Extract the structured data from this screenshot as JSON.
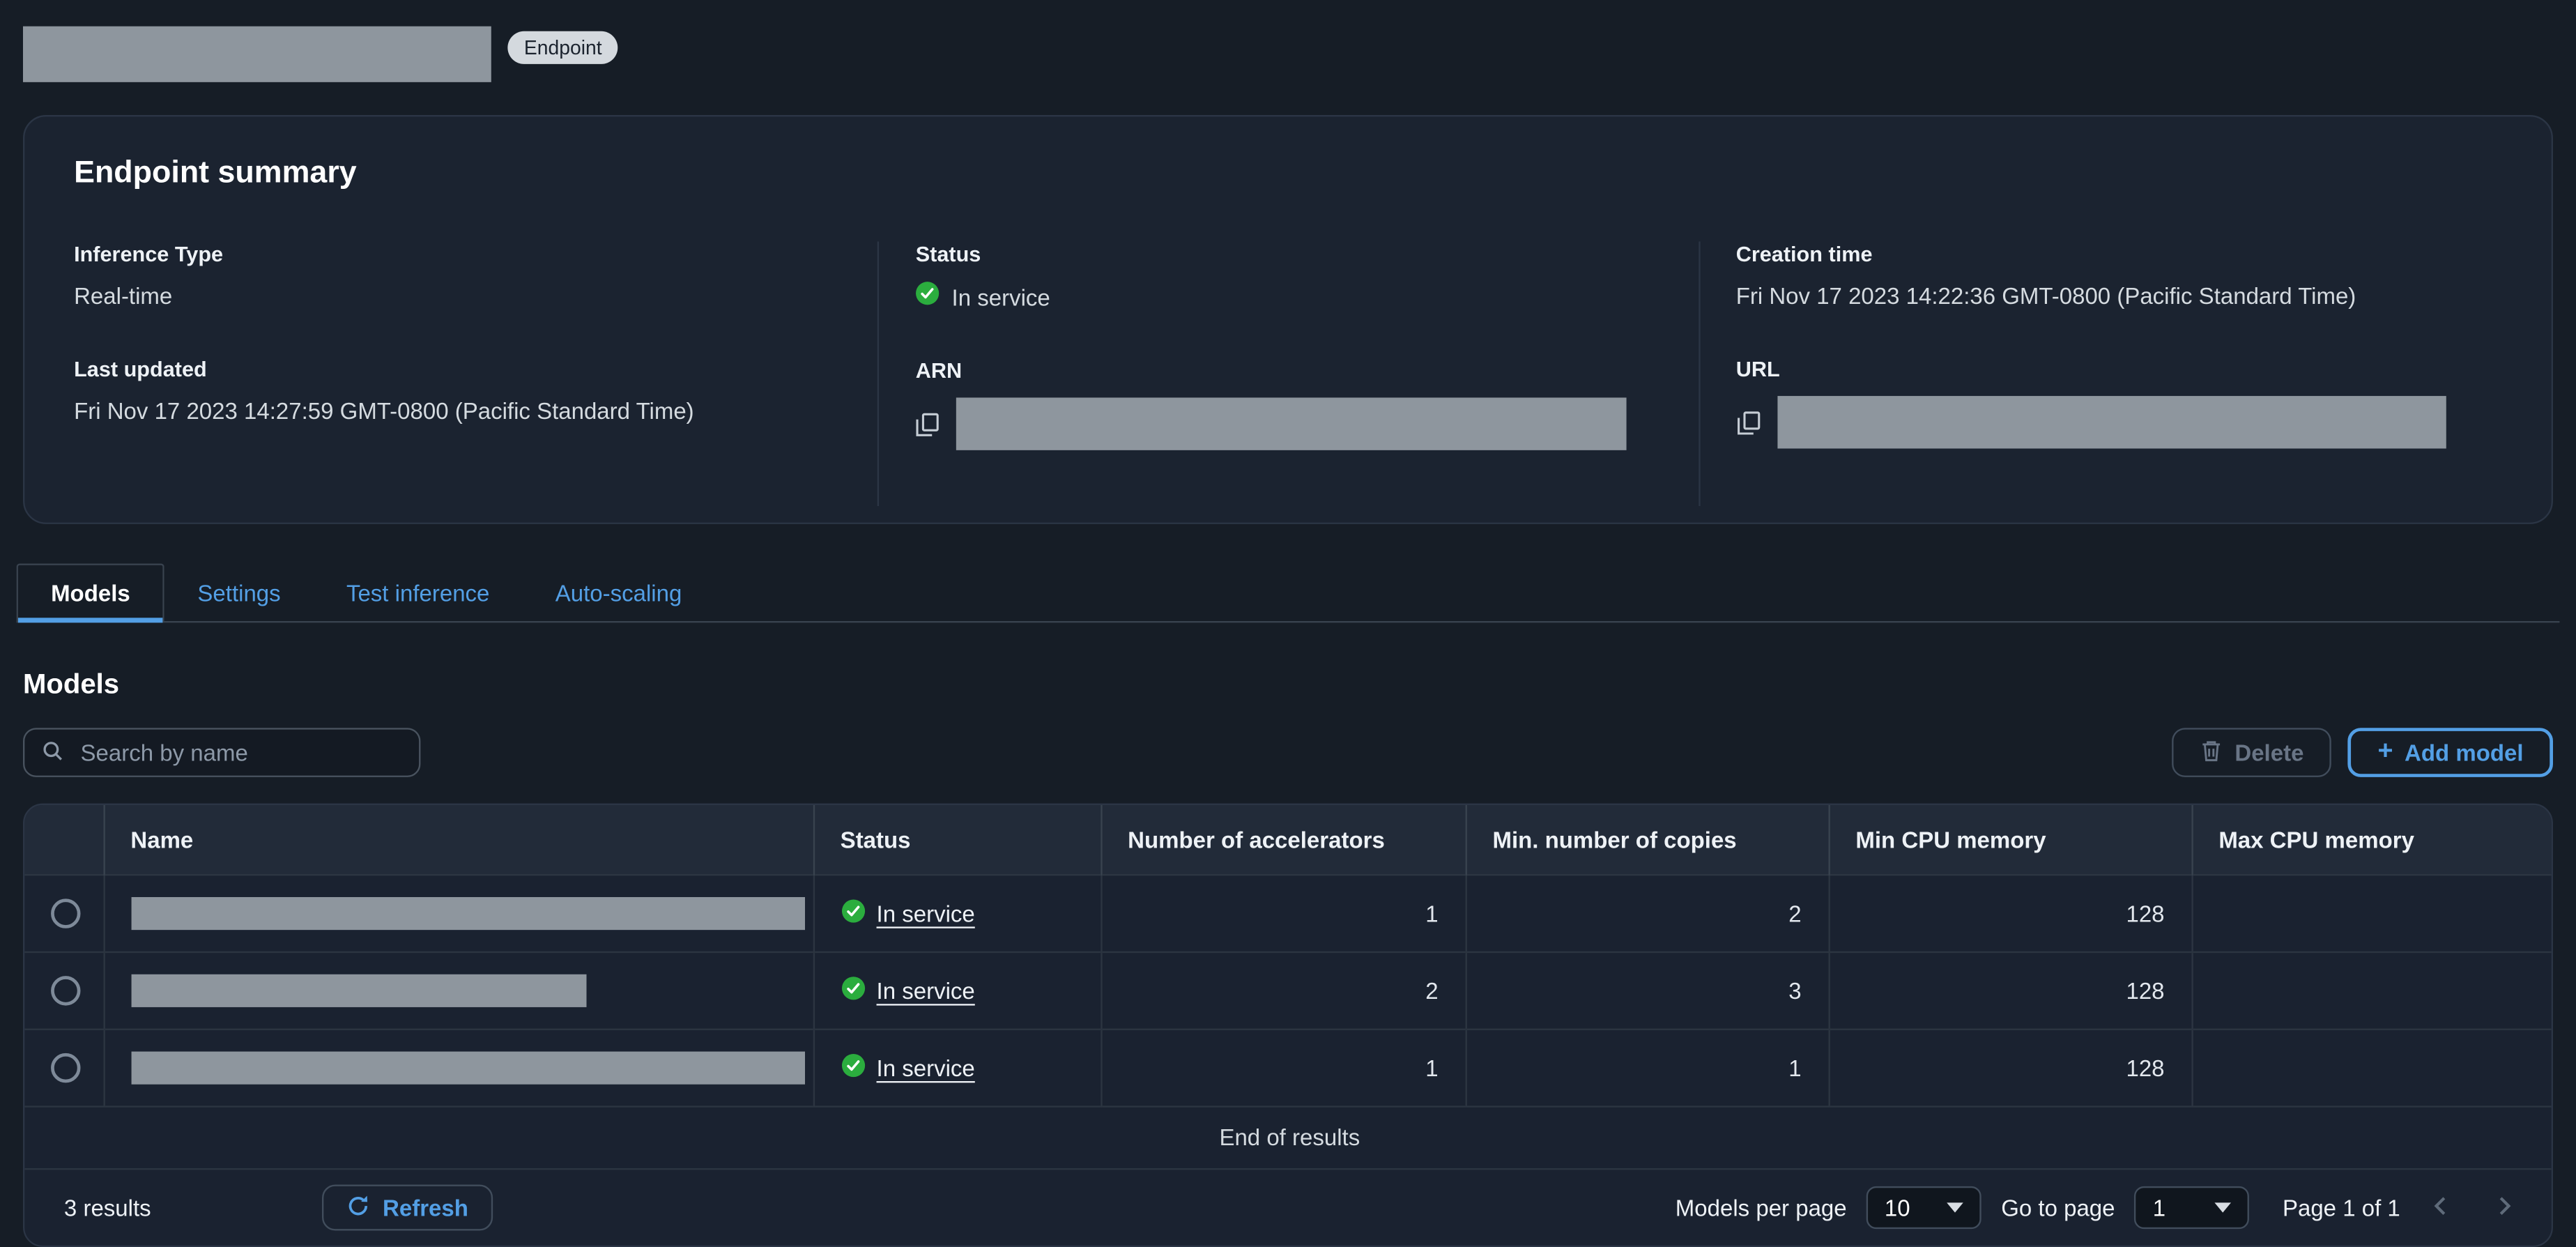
{
  "header": {
    "badge": "Endpoint"
  },
  "summary": {
    "title": "Endpoint summary",
    "inference_type_label": "Inference Type",
    "inference_type_value": "Real-time",
    "status_label": "Status",
    "status_value": "In service",
    "creation_label": "Creation time",
    "creation_value": "Fri Nov 17 2023 14:22:36 GMT-0800 (Pacific Standard Time)",
    "updated_label": "Last updated",
    "updated_value": "Fri Nov 17 2023 14:27:59 GMT-0800 (Pacific Standard Time)",
    "arn_label": "ARN",
    "url_label": "URL"
  },
  "tabs": [
    {
      "label": "Models",
      "selected": true
    },
    {
      "label": "Settings",
      "selected": false
    },
    {
      "label": "Test inference",
      "selected": false
    },
    {
      "label": "Auto-scaling",
      "selected": false
    }
  ],
  "models": {
    "heading": "Models",
    "search_placeholder": "Search by name",
    "delete_label": "Delete",
    "add_plus": "+",
    "add_label": "Add model",
    "table": {
      "columns": [
        "Name",
        "Status",
        "Number of accelerators",
        "Min. number of copies",
        "Min CPU memory",
        "Max CPU memory"
      ],
      "rows": [
        {
          "status": "In service",
          "accelerators": "1",
          "min_copies": "2",
          "min_cpu_memory": "128",
          "max_cpu_memory": ""
        },
        {
          "status": "In service",
          "accelerators": "2",
          "min_copies": "3",
          "min_cpu_memory": "128",
          "max_cpu_memory": ""
        },
        {
          "status": "In service",
          "accelerators": "1",
          "min_copies": "1",
          "min_cpu_memory": "128",
          "max_cpu_memory": ""
        }
      ],
      "end_of_results": "End of results"
    },
    "pagination": {
      "results_text": "3 results",
      "refresh_label": "Refresh",
      "per_page_label": "Models per page",
      "per_page_value": "10",
      "go_to_page_label": "Go to page",
      "go_to_page_value": "1",
      "page_text": "Page 1 of 1"
    }
  },
  "icons": {
    "search": "magnifier",
    "delete": "trash",
    "add": "plus",
    "refresh": "circular-arrow",
    "status_ok": "green-check-circle",
    "copy": "copy-pages",
    "prev": "chevron-left",
    "next": "chevron-right",
    "select_caret": "caret-down"
  },
  "colors": {
    "background": "#161d26",
    "accent": "#539fe5",
    "success_green": "#2bad3e",
    "redaction_gray": "#8e969e"
  }
}
